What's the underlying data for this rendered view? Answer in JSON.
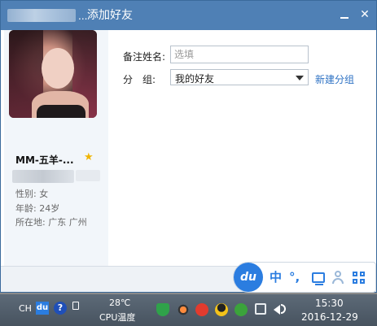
{
  "window": {
    "title": "添加好友",
    "title_dots": "..."
  },
  "profile": {
    "nickname": "MM-五羊-...",
    "gender": "性别: 女",
    "age": "年龄: 24岁",
    "location": "所在地: 广东  广州"
  },
  "form": {
    "remark_label": "备注姓名:",
    "remark_placeholder": "选填",
    "group_label": "分　组:",
    "group_value": "我的好友",
    "new_group_link": "新建分组"
  },
  "ime": {
    "logo": "du",
    "lang": "中",
    "punct": "°,"
  },
  "taskbar": {
    "input_lang": "CH",
    "du_label": "du",
    "help_label": "?",
    "temperature": "28℃",
    "cpu_label": "CPU温度",
    "time": "15:30",
    "date": "2016-12-29"
  },
  "colors": {
    "titlebar": "#4f80b5",
    "link": "#2e72c4",
    "ime_accent": "#2b7de0"
  }
}
